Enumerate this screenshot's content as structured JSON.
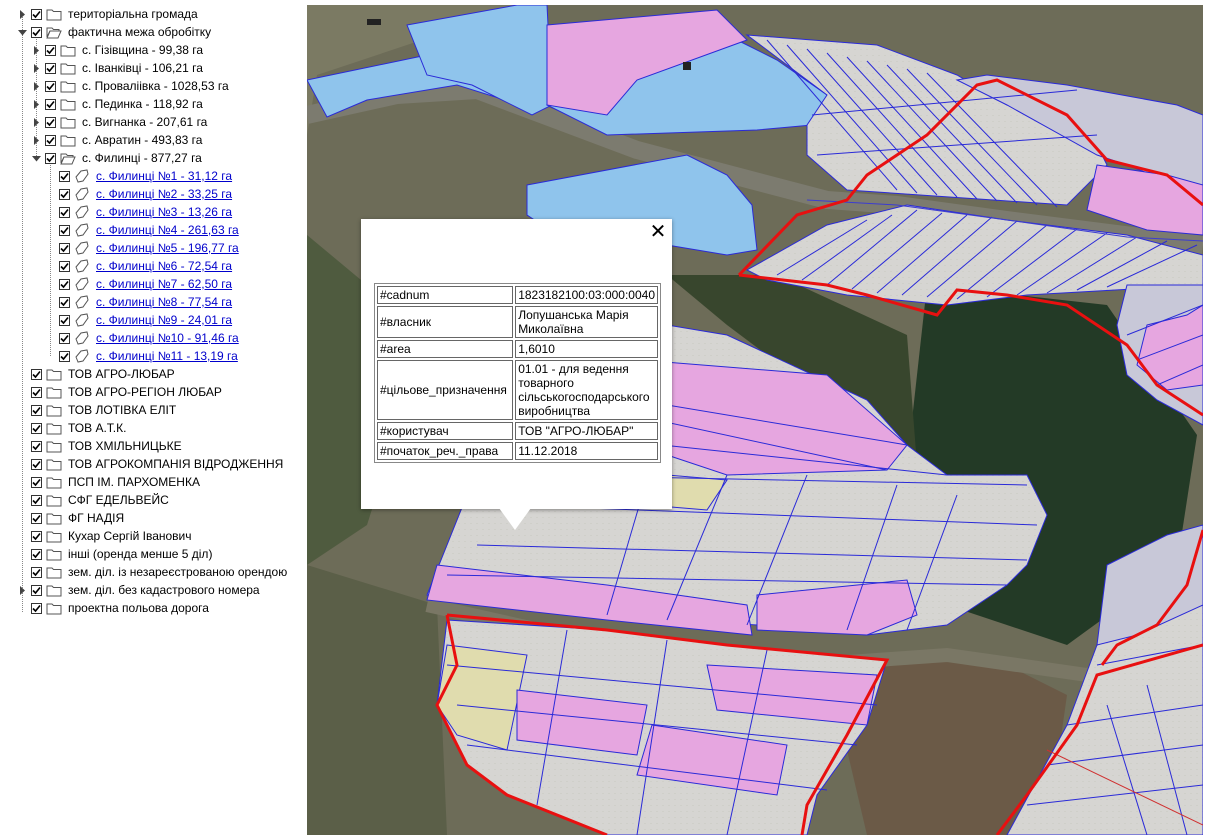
{
  "tree": {
    "items": [
      {
        "label": "територіальна громада",
        "expander": "collapsed",
        "icon": "folder-icon",
        "link": false
      },
      {
        "label": "фактична межа обробітку",
        "expander": "expanded",
        "icon": "folder-open-icon",
        "link": false
      },
      {
        "label": "с. Гізівщина - 99,38 га",
        "expander": "collapsed",
        "icon": "folder-icon",
        "link": false
      },
      {
        "label": "с. Іванківці - 106,21 га",
        "expander": "collapsed",
        "icon": "folder-icon",
        "link": false
      },
      {
        "label": "с. Проваліівка - 1028,53 га",
        "expander": "collapsed",
        "icon": "folder-icon",
        "link": false
      },
      {
        "label": "с. Пединка - 118,92 га",
        "expander": "collapsed",
        "icon": "folder-icon",
        "link": false
      },
      {
        "label": "с. Вигнанка - 207,61 га",
        "expander": "collapsed",
        "icon": "folder-icon",
        "link": false
      },
      {
        "label": "с. Авратин - 493,83 га",
        "expander": "collapsed",
        "icon": "folder-icon",
        "link": false
      },
      {
        "label": "с. Филинці - 877,27 га",
        "expander": "expanded",
        "icon": "folder-open-icon",
        "link": false
      },
      {
        "label": "с. Филинці №1 - 31,12 га",
        "expander": "none",
        "icon": "polygon-icon",
        "link": true
      },
      {
        "label": "с. Филинці №2 - 33,25 га",
        "expander": "none",
        "icon": "polygon-icon",
        "link": true
      },
      {
        "label": "с. Филинці №3 - 13,26 га",
        "expander": "none",
        "icon": "polygon-icon",
        "link": true
      },
      {
        "label": "с. Филинці №4 - 261,63 га",
        "expander": "none",
        "icon": "polygon-icon",
        "link": true
      },
      {
        "label": "с. Филинці №5 - 196,77 га",
        "expander": "none",
        "icon": "polygon-icon",
        "link": true
      },
      {
        "label": "с. Филинці №6 - 72,54 га",
        "expander": "none",
        "icon": "polygon-icon",
        "link": true
      },
      {
        "label": "с. Филинці №7 - 62,50 га",
        "expander": "none",
        "icon": "polygon-icon",
        "link": true
      },
      {
        "label": "с. Филинці №8 - 77,54 га",
        "expander": "none",
        "icon": "polygon-icon",
        "link": true
      },
      {
        "label": "с. Филинці №9 - 24,01 га",
        "expander": "none",
        "icon": "polygon-icon",
        "link": true
      },
      {
        "label": "с. Филинці №10 - 91,46 га",
        "expander": "none",
        "icon": "polygon-icon",
        "link": true
      },
      {
        "label": "с. Филинці №11 - 13,19 га",
        "expander": "none",
        "icon": "polygon-icon",
        "link": true
      },
      {
        "label": "ТОВ АГРО-ЛЮБАР",
        "expander": "none",
        "icon": "folder-icon",
        "link": false
      },
      {
        "label": "ТОВ АГРО-РЕГІОН ЛЮБАР",
        "expander": "none",
        "icon": "folder-icon",
        "link": false
      },
      {
        "label": "ТОВ ЛОТІВКА ЕЛІТ",
        "expander": "none",
        "icon": "folder-icon",
        "link": false
      },
      {
        "label": "ТОВ А.Т.К.",
        "expander": "none",
        "icon": "folder-icon",
        "link": false
      },
      {
        "label": "ТОВ ХМІЛЬНИЦЬКЕ",
        "expander": "none",
        "icon": "folder-icon",
        "link": false
      },
      {
        "label": "ТОВ АГРОКОМПАНІЯ ВІДРОДЖЕННЯ",
        "expander": "none",
        "icon": "folder-icon",
        "link": false
      },
      {
        "label": "ПСП ІМ. ПАРХОМЕНКА",
        "expander": "none",
        "icon": "folder-icon",
        "link": false
      },
      {
        "label": "СФГ ЕДЕЛЬВЕЙС",
        "expander": "none",
        "icon": "folder-icon",
        "link": false
      },
      {
        "label": "ФГ НАДІЯ",
        "expander": "none",
        "icon": "folder-icon",
        "link": false
      },
      {
        "label": "Кухар Сергій Іванович",
        "expander": "none",
        "icon": "folder-icon",
        "link": false
      },
      {
        "label": "інші (оренда менше 5 діл)",
        "expander": "none",
        "icon": "folder-icon",
        "link": false
      },
      {
        "label": "зем. діл. із незареєстрованою орендою",
        "expander": "none",
        "icon": "folder-icon",
        "link": false
      },
      {
        "label": "зем. діл. без кадастрового номера",
        "expander": "collapsed",
        "icon": "folder-icon",
        "link": false
      },
      {
        "label": "проектна польова дорога",
        "expander": "none",
        "icon": "folder-icon",
        "link": false
      }
    ]
  },
  "popup": {
    "close_label": "✕",
    "rows": [
      {
        "key": "#cadnum",
        "value": "1823182100:03:000:0040"
      },
      {
        "key": "#власник",
        "value": "Лопушанська Марія Миколаївна"
      },
      {
        "key": "#area",
        "value": "1,6010"
      },
      {
        "key": "#цільове_призначення",
        "value": "01.01 - для ведення товарного сільськогосподарського виробництва"
      },
      {
        "key": "#користувач",
        "value": "ТОВ \"АГРО-ЛЮБАР\""
      },
      {
        "key": "#початок_реч._права",
        "value": "11.12.2018"
      }
    ]
  },
  "colors": {
    "parcel_fill": "#c8c8d8",
    "parcel_pink": "#e6a6e0",
    "parcel_blue": "#8fc4ec",
    "parcel_yellow": "#e0dcae",
    "parcel_stroke": "#2a2ad8",
    "boundary": "#e81010",
    "link": "#0000cc"
  }
}
